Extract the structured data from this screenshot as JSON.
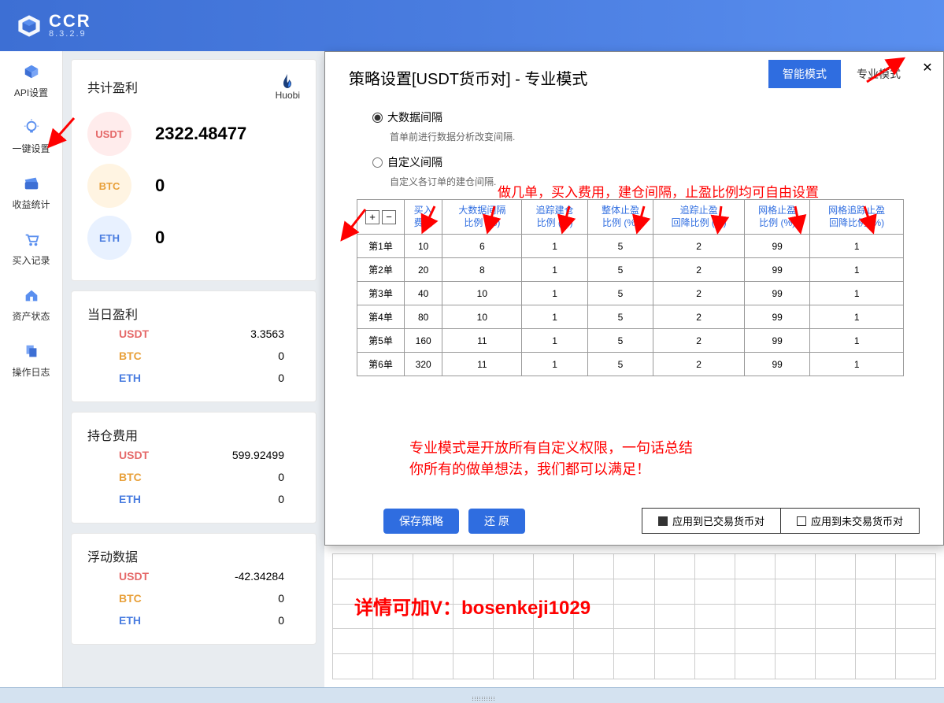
{
  "header": {
    "title": "CCR",
    "version": "8.3.2.9"
  },
  "nav": [
    {
      "label": "API设置",
      "icon": "api"
    },
    {
      "label": "一键设置",
      "icon": "bulb"
    },
    {
      "label": "收益统计",
      "icon": "folder"
    },
    {
      "label": "买入记录",
      "icon": "cart"
    },
    {
      "label": "资产状态",
      "icon": "house"
    },
    {
      "label": "操作日志",
      "icon": "copy"
    }
  ],
  "summary": {
    "total_title": "共计盈利",
    "exchange": "Huobi",
    "total": {
      "usdt": "2322.48477",
      "btc": "0",
      "eth": "0"
    },
    "today_title": "当日盈利",
    "today": {
      "usdt": "3.3563",
      "btc": "0",
      "eth": "0"
    },
    "hold_title": "持仓费用",
    "hold": {
      "usdt": "599.92499",
      "btc": "0",
      "eth": "0"
    },
    "float_title": "浮动数据",
    "float": {
      "usdt": "-42.34284",
      "btc": "0",
      "eth": "0"
    },
    "labels": {
      "usdt": "USDT",
      "btc": "BTC",
      "eth": "ETH"
    }
  },
  "modal": {
    "title": "策略设置[USDT货币对] - 专业模式",
    "tabs": {
      "smart": "智能模式",
      "pro": "专业模式"
    },
    "opt_big": "大数据间隔",
    "opt_big_sub": "首单前进行数据分析改变间隔.",
    "opt_custom": "自定义间隔",
    "opt_custom_sub": "自定义各订单的建仓间隔.",
    "headers": [
      "",
      "买入\n费用",
      "大数据间隔\n比例 (%)",
      "追踪建仓\n比例 (%)",
      "整体止盈\n比例 (%)",
      "追踪止盈\n回降比例 (%)",
      "网格止盈\n比例 (%)",
      "网格追踪止盈\n回降比例 (%)"
    ],
    "rows": [
      {
        "label": "第1单",
        "cells": [
          "10",
          "6",
          "1",
          "5",
          "2",
          "99",
          "1"
        ]
      },
      {
        "label": "第2单",
        "cells": [
          "20",
          "8",
          "1",
          "5",
          "2",
          "99",
          "1"
        ]
      },
      {
        "label": "第3单",
        "cells": [
          "40",
          "10",
          "1",
          "5",
          "2",
          "99",
          "1"
        ]
      },
      {
        "label": "第4单",
        "cells": [
          "80",
          "10",
          "1",
          "5",
          "2",
          "99",
          "1"
        ]
      },
      {
        "label": "第5单",
        "cells": [
          "160",
          "11",
          "1",
          "5",
          "2",
          "99",
          "1"
        ]
      },
      {
        "label": "第6单",
        "cells": [
          "320",
          "11",
          "1",
          "5",
          "2",
          "99",
          "1"
        ]
      }
    ],
    "btn_save": "保存策略",
    "btn_reset": "还 原",
    "apply_traded": "应用到已交易货币对",
    "apply_untraded": "应用到未交易货币对"
  },
  "annotations": {
    "top": "做几单，买入费用，建仓间隔，止盈比例均可自由设置",
    "mid1": "专业模式是开放所有自定义权限，一句话总结",
    "mid2": "你所有的做单想法，我们都可以满足！",
    "bottom": "详情可加V：bosenkeji1029"
  }
}
